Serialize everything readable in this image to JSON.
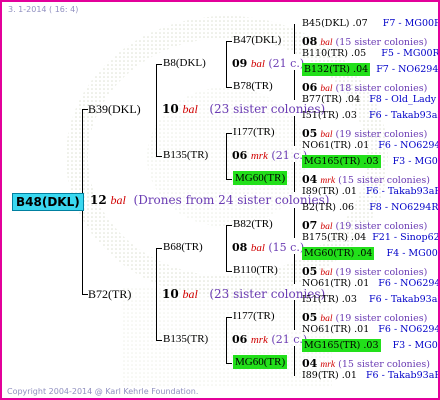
{
  "header_text": "3.  1-2014 ( 16:  4)",
  "footer_text": "Copyright 2004-2014 @ Karl Kehrle Foundation.",
  "root": {
    "name": "B48(DKL)",
    "num": "12",
    "bal": "bal",
    "note": "(Drones from 24 sister colonies)"
  },
  "gen1": [
    {
      "name": "B39(DKL)",
      "num": "10",
      "bal": "bal",
      "note": "(23 sister colonies)"
    },
    {
      "name": "B72(TR)",
      "num": "10",
      "bal": "bal",
      "note": "(23 sister colonies)"
    }
  ],
  "gen2": [
    {
      "name": "B8(DKL)",
      "num": "09",
      "bal": "bal",
      "note": "(21 c.)"
    },
    {
      "name": "B135(TR)",
      "num": "06",
      "bal": "mrk",
      "note": "(21 c.)"
    },
    {
      "name": "B68(TR)",
      "num": "08",
      "bal": "bal",
      "note": "(15 c.)"
    },
    {
      "name": "B135(TR)",
      "num": "06",
      "bal": "mrk",
      "note": "(21 c.)"
    }
  ],
  "gen3": [
    {
      "name": "B47(DKL)",
      "num": "08",
      "bal": "bal",
      "note": "(15 sister colonies)"
    },
    {
      "name": "B78(TR)",
      "num": "06",
      "bal": "bal",
      "note": "(18 sister colonies)"
    },
    {
      "name": "I177(TR)",
      "num": "05",
      "bal": "bal",
      "note": "(19 sister colonies)"
    },
    {
      "name": "MG60(TR)",
      "num": "04",
      "bal": "mrk",
      "note": "(15 sister colonies)"
    },
    {
      "name": "B82(TR)",
      "num": "07",
      "bal": "bal",
      "note": "(19 sister colonies)"
    },
    {
      "name": "B110(TR)",
      "num": "05",
      "bal": "bal",
      "note": "(19 sister colonies)"
    },
    {
      "name": "I177(TR)",
      "num": "05",
      "bal": "bal",
      "note": "(19 sister colonies)"
    },
    {
      "name": "MG60(TR)",
      "num": "04",
      "bal": "mrk",
      "note": "(15 sister colonies)"
    }
  ],
  "gen4": [
    {
      "name": "B45(DKL)",
      "year": ".07",
      "line": "F7 - MG00R"
    },
    {
      "name": "B110(TR)",
      "year": ".05",
      "line": "F5 - MG00R"
    },
    {
      "name": "B132(TR)",
      "year": ".04",
      "line": "F7 - NO6294R"
    },
    {
      "name": "B77(TR)",
      "year": ".04",
      "line": "F8 - Old_Lady"
    },
    {
      "name": "I51(TR)",
      "year": ".03",
      "line": "F6 - Takab93aR"
    },
    {
      "name": "NO61(TR)",
      "year": ".01",
      "line": "F6 - NO6294R"
    },
    {
      "name": "MG165(TR)",
      "year": ".03",
      "line": "F3 - MG00R"
    },
    {
      "name": "I89(TR)",
      "year": ".01",
      "line": "F6 - Takab93aR"
    },
    {
      "name": "B2(TR)",
      "year": ".06",
      "line": "F8 - NO6294R"
    },
    {
      "name": "B175(TR)",
      "year": ".04",
      "line": "F21 - Sinop62R"
    },
    {
      "name": "MG60(TR)",
      "year": ".04",
      "line": "F4 - MG00R"
    },
    {
      "name": "NO61(TR)",
      "year": ".01",
      "line": "F6 - NO6294R"
    },
    {
      "name": "I51(TR)",
      "year": ".03",
      "line": "F6 - Takab93aR"
    },
    {
      "name": "NO61(TR)",
      "year": ".01",
      "line": "F6 - NO6294R"
    },
    {
      "name": "MG165(TR)",
      "year": ".03",
      "line": "F3 - MG00R"
    },
    {
      "name": "I89(TR)",
      "year": ".01",
      "line": "F6 - Takab93aR"
    }
  ]
}
